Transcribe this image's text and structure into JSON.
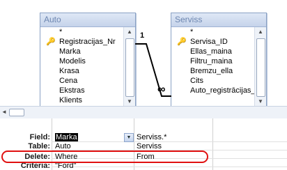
{
  "tables": [
    {
      "name": "Auto",
      "fields": [
        {
          "label": "*",
          "key": false
        },
        {
          "label": "Registracijas_Nr",
          "key": true
        },
        {
          "label": "Marka",
          "key": false
        },
        {
          "label": "Modelis",
          "key": false
        },
        {
          "label": "Krasa",
          "key": false
        },
        {
          "label": "Cena",
          "key": false
        },
        {
          "label": "Ekstras",
          "key": false
        },
        {
          "label": "Klients",
          "key": false
        }
      ]
    },
    {
      "name": "Serviss",
      "fields": [
        {
          "label": "*",
          "key": false
        },
        {
          "label": "Servisa_ID",
          "key": true
        },
        {
          "label": "Ellas_maina",
          "key": false
        },
        {
          "label": "Filtru_maina",
          "key": false
        },
        {
          "label": "Bremzu_ella",
          "key": false
        },
        {
          "label": "Cits",
          "key": false
        },
        {
          "label": "Auto_registrācijas_N",
          "key": false
        }
      ]
    }
  ],
  "relationship": {
    "one_label": "1",
    "many_label": "∞"
  },
  "grid": {
    "rows": [
      {
        "label": "Field:",
        "col1": "Marka",
        "col2": "Serviss.*"
      },
      {
        "label": "Table:",
        "col1": "Auto",
        "col2": "Serviss"
      },
      {
        "label": "Delete:",
        "col1": "Where",
        "col2": "From"
      },
      {
        "label": "Criteria:",
        "col1": "\"Ford\"",
        "col2": ""
      }
    ]
  },
  "colors": {
    "highlight": "#e01010",
    "header_text": "#6d86b0"
  }
}
